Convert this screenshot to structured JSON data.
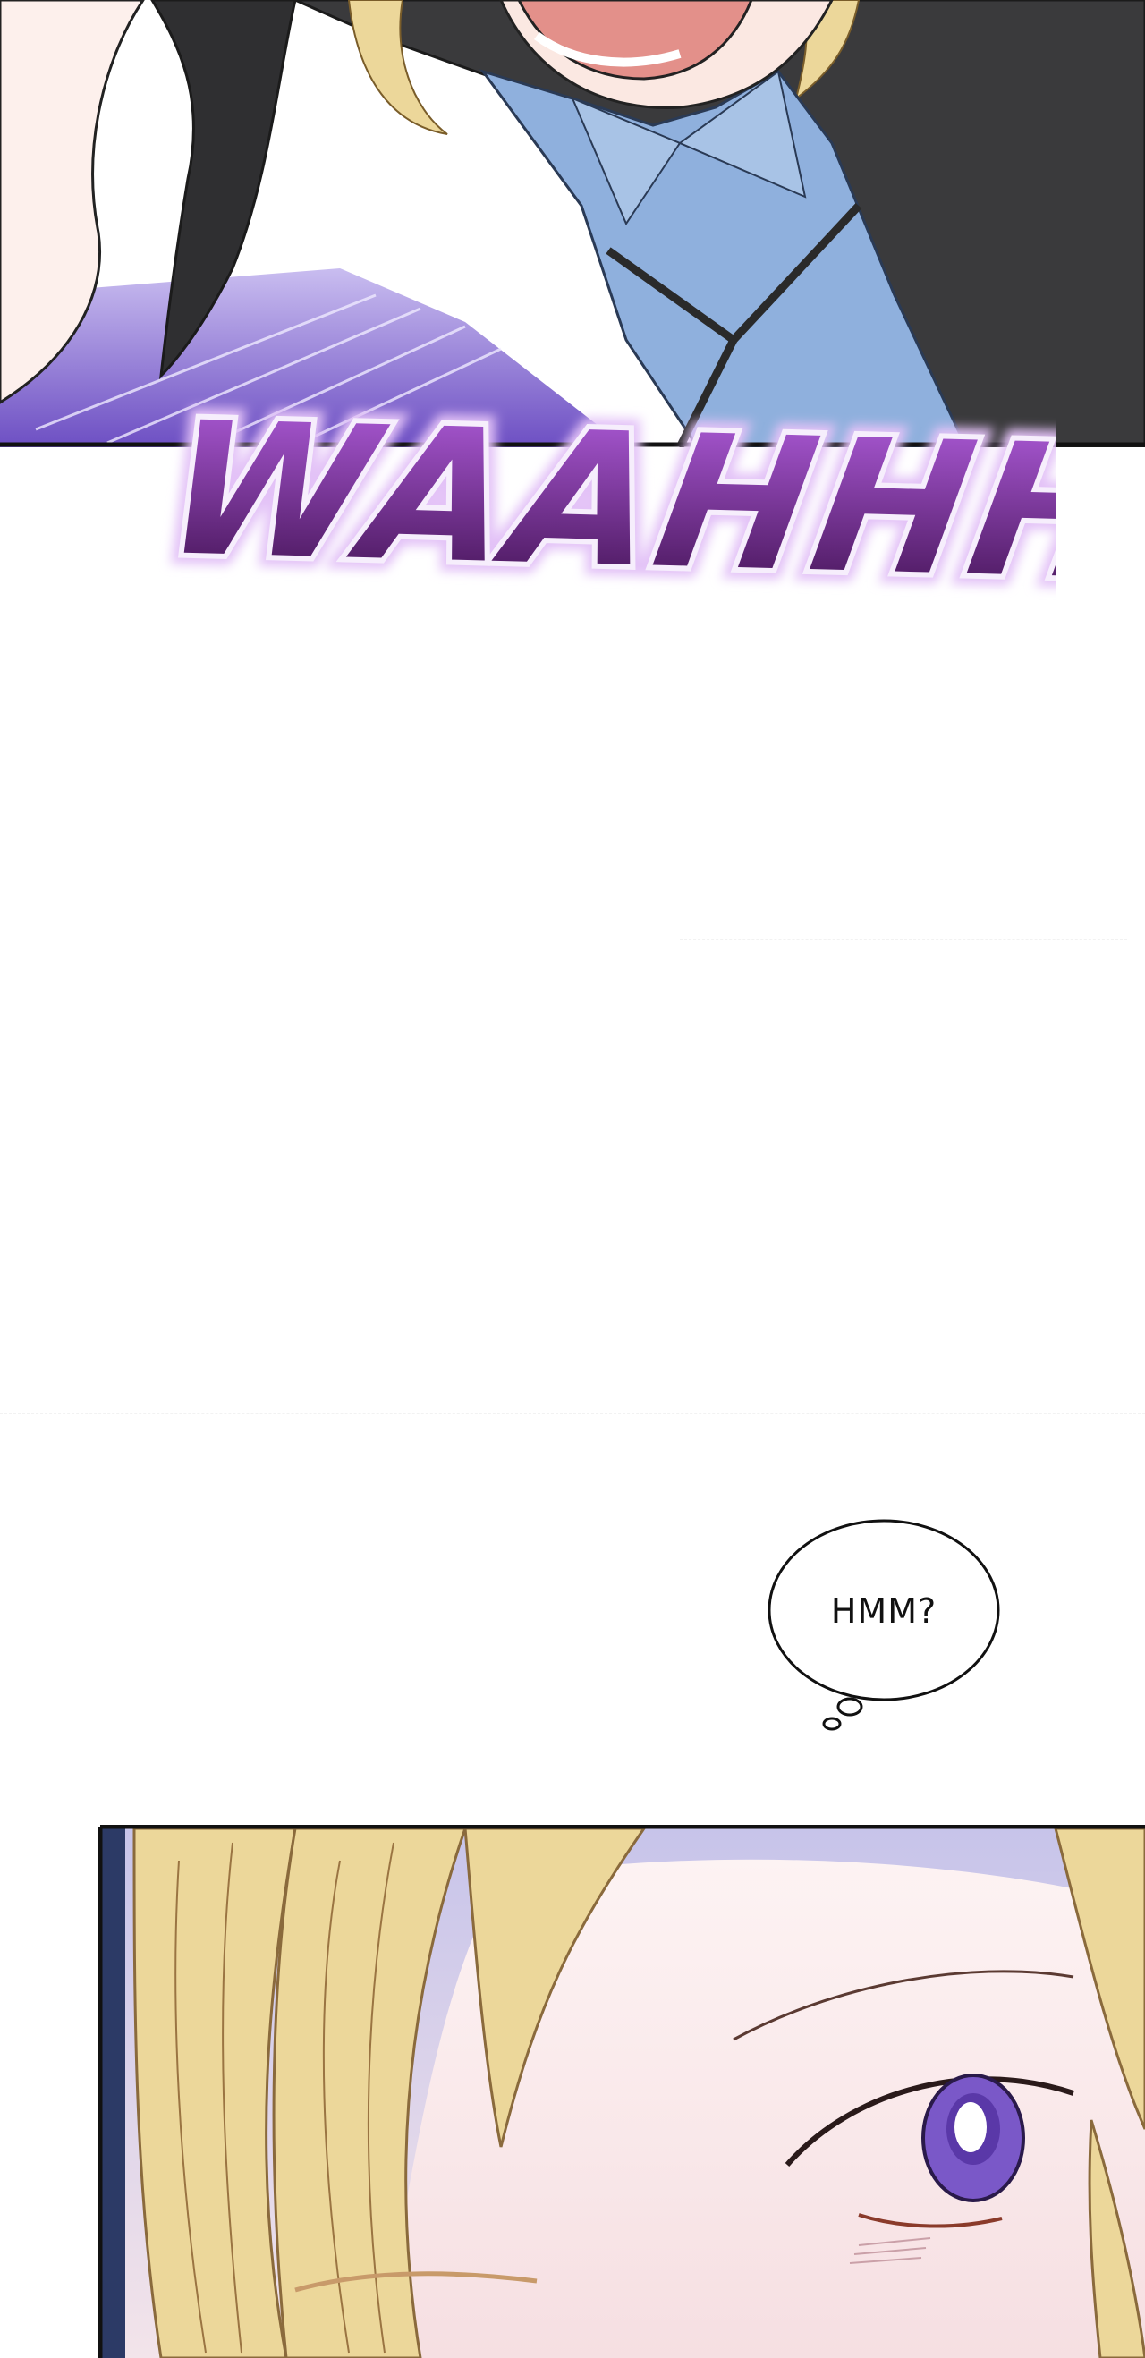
{
  "comic": {
    "sound_effect": "WAAHHH",
    "speech_bubble": "HMM?"
  },
  "colors": {
    "sfx_top": "#b35fe0",
    "sfx_bottom": "#3e0f4e",
    "sfx_glow": "#d9a8f5",
    "shirt": "#8fb0dd",
    "coat": "#3a3a3c",
    "hair_blonde": "#ecd79a",
    "skin": "#fbeeea",
    "eye": "#7a58c8",
    "speed_lines": "#8e7ad6"
  }
}
